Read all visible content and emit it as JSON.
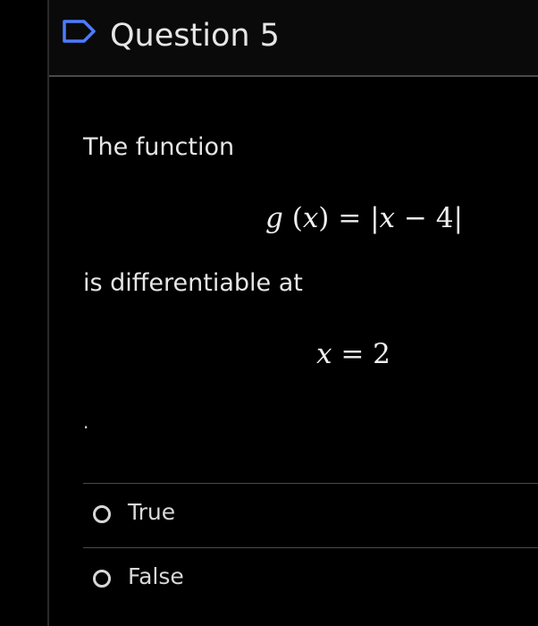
{
  "header": {
    "question_label": "Question 5"
  },
  "question": {
    "intro": "The function",
    "equation": {
      "fn": "g",
      "var": "x",
      "constant": "4"
    },
    "middle_text": "is differentiable at",
    "point": {
      "var": "x",
      "value": "2"
    },
    "trailing_period": "."
  },
  "choices": [
    {
      "label": "True",
      "selected": false
    },
    {
      "label": "False",
      "selected": false
    }
  ],
  "colors": {
    "background": "#000000",
    "header_background": "#0a0a0a",
    "text": "#e6e6e6",
    "divider": "#4a4a4a"
  },
  "icons": {
    "flag": "flag-outline-icon",
    "radio": "radio-unselected-icon"
  }
}
